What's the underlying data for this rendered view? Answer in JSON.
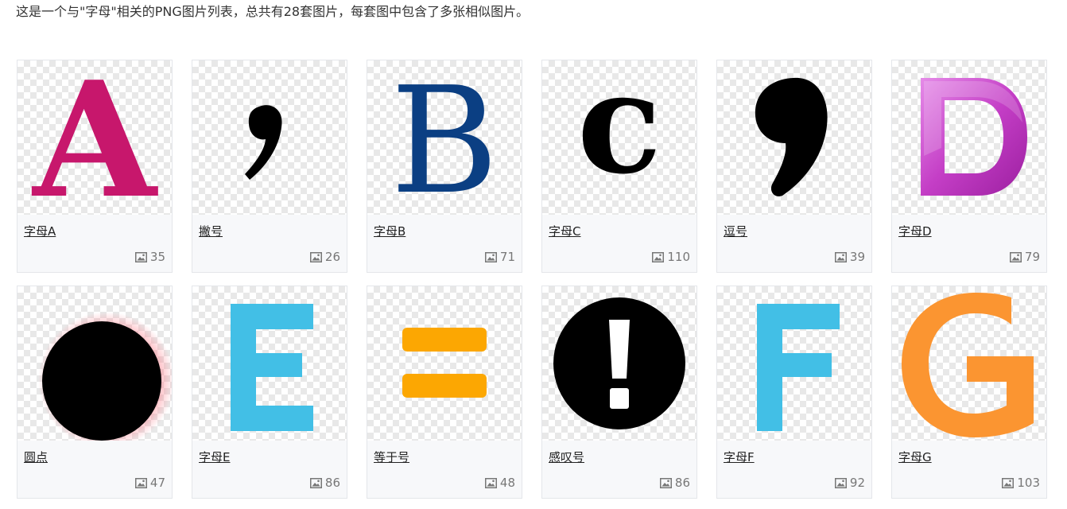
{
  "intro": "这是一个与\"字母\"相关的PNG图片列表，总共有28套图片，每套图中包含了多张相似图片。",
  "cards": [
    {
      "title": "字母A",
      "count": "35",
      "icon": "letter-a-magenta"
    },
    {
      "title": "撇号",
      "count": "26",
      "icon": "apostrophe-black"
    },
    {
      "title": "字母B",
      "count": "71",
      "icon": "letter-b-navy"
    },
    {
      "title": "字母C",
      "count": "110",
      "icon": "letter-c-black"
    },
    {
      "title": "逗号",
      "count": "39",
      "icon": "comma-black"
    },
    {
      "title": "字母D",
      "count": "79",
      "icon": "letter-d-purple"
    },
    {
      "title": "圆点",
      "count": "47",
      "icon": "dot-black"
    },
    {
      "title": "字母E",
      "count": "86",
      "icon": "letter-e-skyblue"
    },
    {
      "title": "等于号",
      "count": "48",
      "icon": "equals-orange"
    },
    {
      "title": "感叹号",
      "count": "86",
      "icon": "exclamation-circle-black"
    },
    {
      "title": "字母F",
      "count": "92",
      "icon": "letter-f-skyblue"
    },
    {
      "title": "字母G",
      "count": "103",
      "icon": "letter-g-orange"
    }
  ],
  "colors": {
    "magenta": "#c7176c",
    "navy": "#0b3f83",
    "purple": "#c43ec6",
    "skyblue": "#42bfe6",
    "orange_equals": "#fca702",
    "orange_g": "#fb9531"
  }
}
